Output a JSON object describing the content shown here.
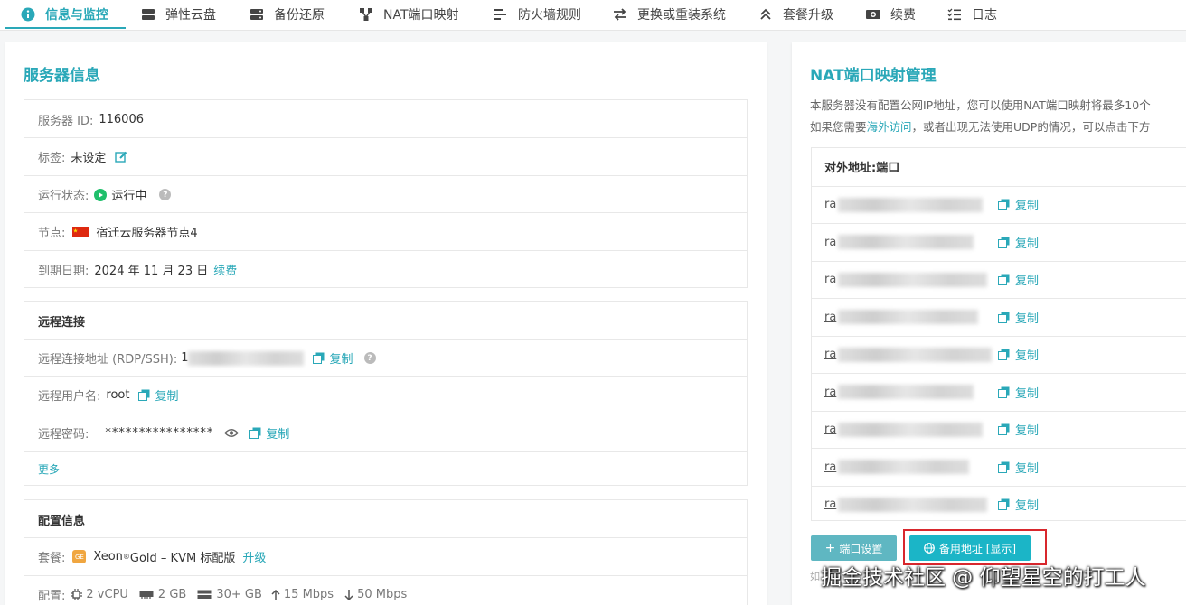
{
  "tabs": [
    {
      "label": "信息与监控",
      "icon": "info-icon"
    },
    {
      "label": "弹性云盘",
      "icon": "disk-icon"
    },
    {
      "label": "备份还原",
      "icon": "backup-icon"
    },
    {
      "label": "NAT端口映射",
      "icon": "nat-icon"
    },
    {
      "label": "防火墙规则",
      "icon": "firewall-icon"
    },
    {
      "label": "更换或重装系统",
      "icon": "swap-icon"
    },
    {
      "label": "套餐升级",
      "icon": "upgrade-icon"
    },
    {
      "label": "续费",
      "icon": "renew-icon"
    },
    {
      "label": "日志",
      "icon": "log-icon"
    }
  ],
  "server": {
    "title": "服务器信息",
    "id_label": "服务器 ID:",
    "id_value": "116006",
    "tag_label": "标签:",
    "tag_value": "未设定",
    "status_label": "运行状态:",
    "status_value": "运行中",
    "node_label": "节点:",
    "node_value": "宿迁云服务器节点4",
    "expire_label": "到期日期:",
    "expire_value": "2024 年 11 月 23 日",
    "renew_link": "续费"
  },
  "remote": {
    "title": "远程连接",
    "addr_label": "远程连接地址 (RDP/SSH):",
    "addr_prefix": "1",
    "copy_label": "复制",
    "user_label": "远程用户名:",
    "user_value": "root",
    "pwd_label": "远程密码:",
    "pwd_value": "****************",
    "more": "更多"
  },
  "config": {
    "title": "配置信息",
    "plan_label": "套餐:",
    "plan_badge": "GE",
    "plan_name": "Xeon",
    "plan_reg": "®",
    "plan_rest": " Gold – KVM 标配版",
    "upgrade_link": "升级",
    "spec_label": "配置:",
    "cpu": "2 vCPU",
    "ram": "2 GB",
    "disk": "30+ GB",
    "up": "15 Mbps",
    "down": "50 Mbps"
  },
  "nat": {
    "title": "NAT端口映射管理",
    "desc1": "本服务器没有配置公网IP地址，您可以使用NAT端口映射将最多10个",
    "desc2_a": "如果您需要",
    "desc2_link": "海外访问",
    "desc2_b": "，或者出现无法使用UDP的情况，可以点击下方",
    "header": "对外地址:端口",
    "addr_prefix": "ra",
    "copy_label": "复制",
    "port_btn": "端口设置",
    "backup_btn": "备用地址 [显示]",
    "foot_prefix": "如"
  },
  "watermark": "掘金技术社区 @ 仰望星空的打工人",
  "colors": {
    "accent": "#2aa8b8",
    "button": "#1bb5c7",
    "highlight": "#d8272d",
    "status": "#1fbf6b"
  }
}
